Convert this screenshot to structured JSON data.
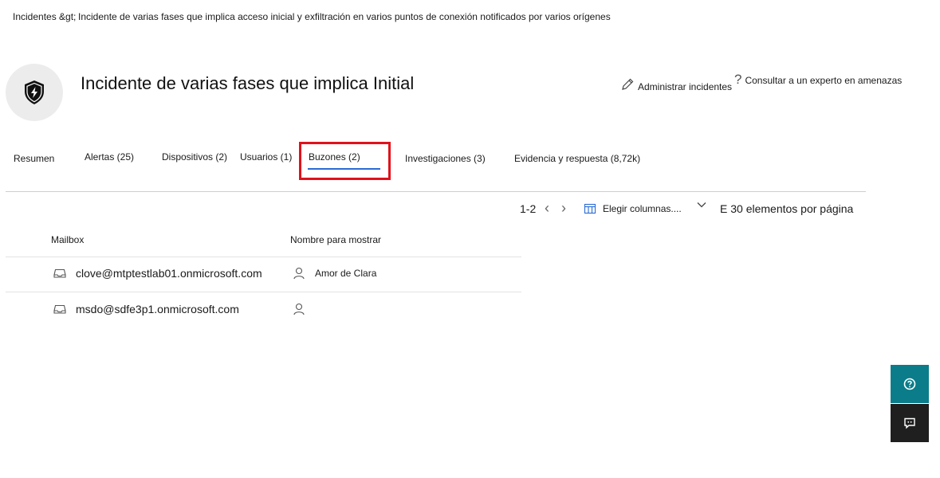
{
  "breadcrumb": {
    "root": "Incidentes &gt;",
    "current": "Incidente de varias fases que implica acceso inicial y exfiltración en varios puntos de conexión notificados por varios orígenes"
  },
  "header": {
    "title": "Incidente de varias fases que implica Initial",
    "manage_label": "Administrar incidentes",
    "expert_label": "Consultar a un experto en amenazas"
  },
  "tabs": [
    {
      "label": "Resumen"
    },
    {
      "label": "Alertas (25)"
    },
    {
      "label": "Dispositivos (2)"
    },
    {
      "label": "Usuarios (1)"
    },
    {
      "label": "Buzones (2)"
    },
    {
      "label": "Investigaciones (3)"
    },
    {
      "label": "Evidencia y respuesta (8,72k)"
    }
  ],
  "active_tab": "Buzones (2)",
  "toolbar": {
    "range": "1-2",
    "choose_columns": "Elegir columnas....",
    "per_page": "E 30 elementos por página"
  },
  "table": {
    "columns": [
      "Mailbox",
      "Nombre para mostrar"
    ],
    "rows": [
      {
        "mailbox": "clove@mtptestlab01.onmicrosoft.com",
        "display_name": "Amor de Clara"
      },
      {
        "mailbox": "msdo@sdfe3p1.onmicrosoft.com",
        "display_name": ""
      }
    ]
  },
  "colors": {
    "accent": "#2a6bd1",
    "highlight": "#e0121b",
    "help": "#0b7d8a",
    "feedback": "#1f1f1f"
  }
}
